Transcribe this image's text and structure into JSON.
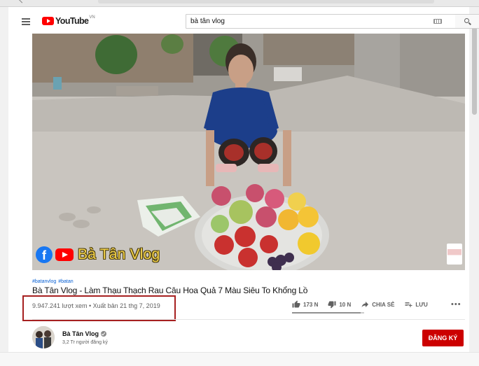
{
  "masthead": {
    "menu_icon": "hamburger-menu-icon",
    "logo_text": "YouTube",
    "logo_country": "VN",
    "search_value": "bà tân vlog",
    "keyboard_icon": "keyboard-icon",
    "search_icon": "search-icon"
  },
  "player": {
    "watermark_text": "Bà Tân Vlog",
    "watermark_icons": [
      "facebook-icon",
      "youtube-icon"
    ]
  },
  "video": {
    "hashtags": [
      "#batanvlog",
      "#batan"
    ],
    "title": "Bà Tân Vlog - Làm Thạu Thạch Rau Câu Hoa Quả 7 Màu Siêu To Khổng Lồ",
    "views": "9.947.241 lượt xem",
    "separator": " • ",
    "published": "Xuất bản 21 thg 7, 2019",
    "like_fraction": 0.95
  },
  "actions": {
    "like_count": "173 N",
    "dislike_count": "10 N",
    "share_label": "CHIA SẺ",
    "save_label": "LƯU",
    "more_label": "•••"
  },
  "owner": {
    "channel_name": "Bà Tân Vlog",
    "subscribers": "3,2 Tr người đăng ký",
    "subscribe_label": "ĐĂNG KÝ"
  },
  "colors": {
    "brand_red": "#ff0000",
    "subscribe_red": "#cc0000",
    "highlight_border": "#a62020",
    "hashtag_blue": "#065fd4",
    "watermark_yellow": "#f3d24b"
  }
}
